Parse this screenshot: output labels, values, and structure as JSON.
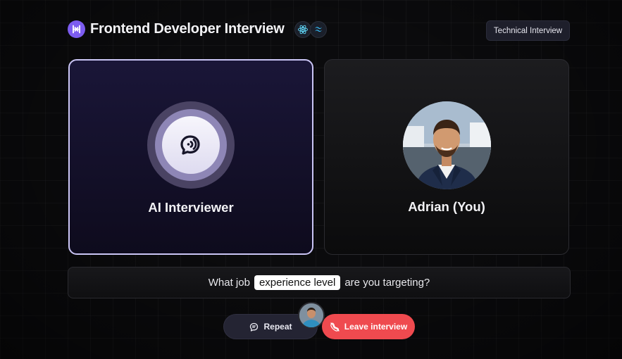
{
  "header": {
    "title": "Frontend Developer Interview",
    "logo_icon": "interview-logo-icon",
    "tech_stack": [
      "react-icon",
      "tailwind-icon"
    ],
    "badge": "Technical Interview"
  },
  "interviewer": {
    "label": "AI Interviewer",
    "icon": "chat-voice-icon"
  },
  "candidate": {
    "label": "Adrian (You)"
  },
  "question": {
    "before": "What job",
    "highlight": "experience level",
    "after": "are you targeting?"
  },
  "controls": {
    "repeat_label": "Repeat",
    "leave_label": "Leave interview"
  },
  "colors": {
    "accent": "#7c5cf0",
    "leave": "#ef4a4f",
    "ai_border": "#cac5f5"
  }
}
